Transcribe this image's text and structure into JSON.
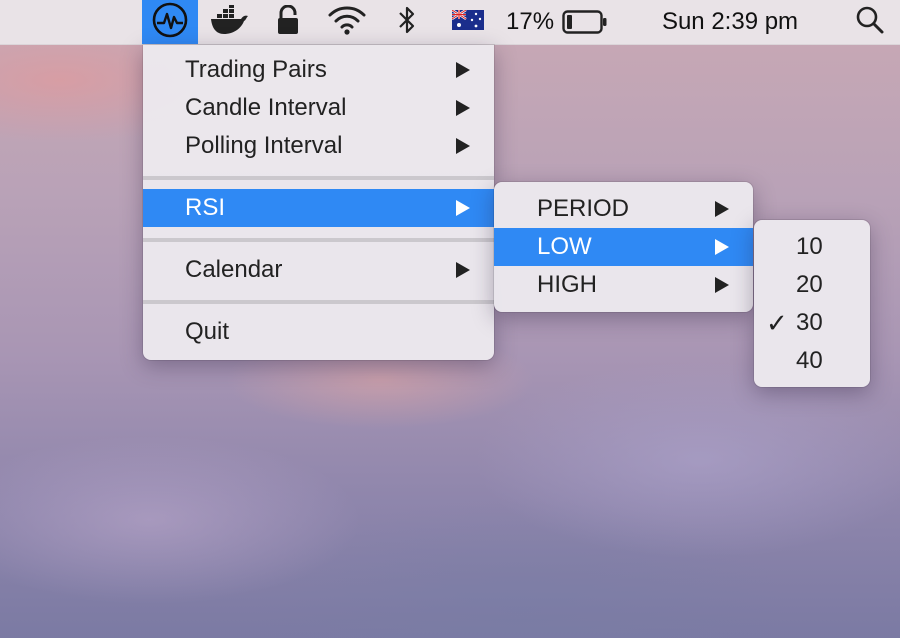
{
  "menubar": {
    "icons": {
      "app": "pulse-icon",
      "docker": "docker-whale-icon",
      "lock": "lock-icon",
      "wifi": "wifi-icon",
      "bluetooth": "bluetooth-icon",
      "flag": "australia-flag-icon",
      "battery": "battery-icon",
      "search": "search-icon"
    },
    "battery_percent": "17%",
    "battery_level": 0.17,
    "clock": "Sun 2:39 pm",
    "accent": "#2f89f4"
  },
  "main_menu": {
    "items": [
      {
        "label": "Trading Pairs"
      },
      {
        "label": "Candle Interval"
      },
      {
        "label": "Polling Interval"
      },
      {
        "label": "RSI"
      },
      {
        "label": "Calendar"
      },
      {
        "label": "Quit"
      }
    ]
  },
  "rsi_menu": {
    "items": [
      {
        "label": "PERIOD"
      },
      {
        "label": "LOW"
      },
      {
        "label": "HIGH"
      }
    ]
  },
  "low_menu": {
    "items": [
      {
        "label": "10"
      },
      {
        "label": "20"
      },
      {
        "label": "30",
        "checked": true
      },
      {
        "label": "40"
      }
    ],
    "check_mark": "✓"
  }
}
